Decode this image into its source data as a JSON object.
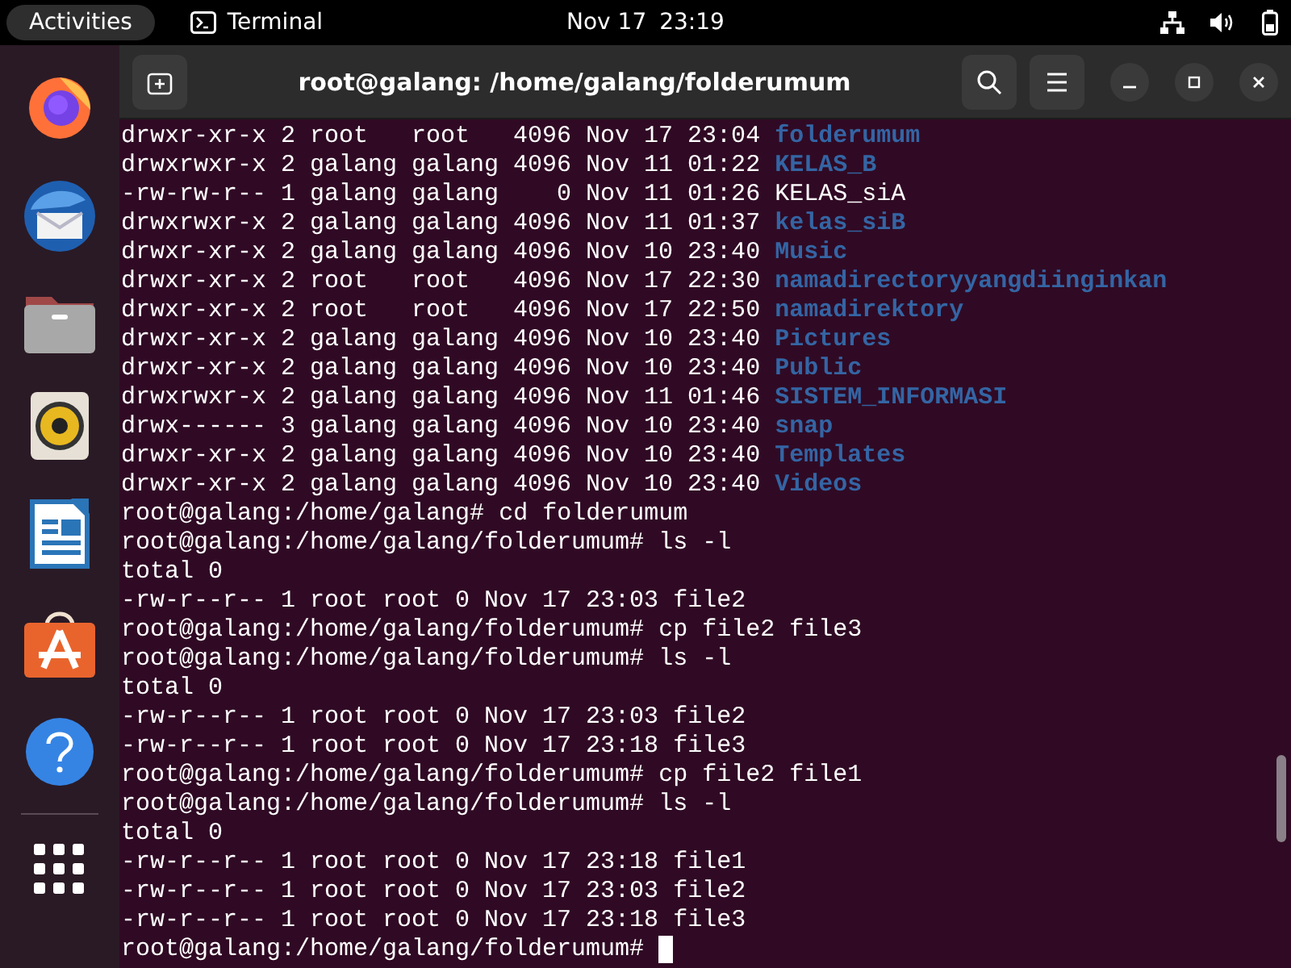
{
  "top_bar": {
    "activities": "Activities",
    "app_name": "Terminal",
    "date": "Nov 17",
    "time": "23:19"
  },
  "dock": {
    "items": [
      {
        "kind": "firefox"
      },
      {
        "kind": "thunderbird"
      },
      {
        "kind": "files"
      },
      {
        "kind": "rhythmbox"
      },
      {
        "kind": "writer"
      },
      {
        "kind": "software"
      },
      {
        "kind": "help"
      },
      {
        "kind": "apps"
      }
    ]
  },
  "window": {
    "title": "root@galang: /home/galang/folderumum"
  },
  "terminal": {
    "lines": [
      {
        "kind": "entry",
        "info": "drwxr-xr-x 2 root   root   4096 Nov 17 23:04",
        "name": "folderumum",
        "directory": true
      },
      {
        "kind": "entry",
        "info": "drwxrwxr-x 2 galang galang 4096 Nov 11 01:22",
        "name": "KELAS_B",
        "directory": true
      },
      {
        "kind": "entry",
        "info": "-rw-rw-r-- 1 galang galang    0 Nov 11 01:26",
        "name": "KELAS_siA",
        "directory": false
      },
      {
        "kind": "entry",
        "info": "drwxrwxr-x 2 galang galang 4096 Nov 11 01:37",
        "name": "kelas_siB",
        "directory": true
      },
      {
        "kind": "entry",
        "info": "drwxr-xr-x 2 galang galang 4096 Nov 10 23:40",
        "name": "Music",
        "directory": true
      },
      {
        "kind": "entry",
        "info": "drwxr-xr-x 2 root   root   4096 Nov 17 22:30",
        "name": "namadirectoryyangdiinginkan",
        "directory": true
      },
      {
        "kind": "entry",
        "info": "drwxr-xr-x 2 root   root   4096 Nov 17 22:50",
        "name": "namadirektory",
        "directory": true
      },
      {
        "kind": "entry",
        "info": "drwxr-xr-x 2 galang galang 4096 Nov 10 23:40",
        "name": "Pictures",
        "directory": true
      },
      {
        "kind": "entry",
        "info": "drwxr-xr-x 2 galang galang 4096 Nov 10 23:40",
        "name": "Public",
        "directory": true
      },
      {
        "kind": "entry",
        "info": "drwxrwxr-x 2 galang galang 4096 Nov 11 01:46",
        "name": "SISTEM_INFORMASI",
        "directory": true
      },
      {
        "kind": "entry",
        "info": "drwx------ 3 galang galang 4096 Nov 10 23:40",
        "name": "snap",
        "directory": true
      },
      {
        "kind": "entry",
        "info": "drwxr-xr-x 2 galang galang 4096 Nov 10 23:40",
        "name": "Templates",
        "directory": true
      },
      {
        "kind": "entry",
        "info": "drwxr-xr-x 2 galang galang 4096 Nov 10 23:40",
        "name": "Videos",
        "directory": true
      },
      {
        "kind": "prompt",
        "prompt": "root@galang:/home/galang#",
        "command": "cd folderumum",
        "cursor": false
      },
      {
        "kind": "prompt",
        "prompt": "root@galang:/home/galang/folderumum#",
        "command": "ls -l",
        "cursor": false
      },
      {
        "kind": "output",
        "text": "total 0"
      },
      {
        "kind": "entry",
        "info": "-rw-r--r-- 1 root root 0 Nov 17 23:03",
        "name": "file2",
        "directory": false
      },
      {
        "kind": "prompt",
        "prompt": "root@galang:/home/galang/folderumum#",
        "command": "cp file2 file3",
        "cursor": false
      },
      {
        "kind": "prompt",
        "prompt": "root@galang:/home/galang/folderumum#",
        "command": "ls -l",
        "cursor": false
      },
      {
        "kind": "output",
        "text": "total 0"
      },
      {
        "kind": "entry",
        "info": "-rw-r--r-- 1 root root 0 Nov 17 23:03",
        "name": "file2",
        "directory": false
      },
      {
        "kind": "entry",
        "info": "-rw-r--r-- 1 root root 0 Nov 17 23:18",
        "name": "file3",
        "directory": false
      },
      {
        "kind": "prompt",
        "prompt": "root@galang:/home/galang/folderumum#",
        "command": "cp file2 file1",
        "cursor": false
      },
      {
        "kind": "prompt",
        "prompt": "root@galang:/home/galang/folderumum#",
        "command": "ls -l",
        "cursor": false
      },
      {
        "kind": "output",
        "text": "total 0"
      },
      {
        "kind": "entry",
        "info": "-rw-r--r-- 1 root root 0 Nov 17 23:18",
        "name": "file1",
        "directory": false
      },
      {
        "kind": "entry",
        "info": "-rw-r--r-- 1 root root 0 Nov 17 23:03",
        "name": "file2",
        "directory": false
      },
      {
        "kind": "entry",
        "info": "-rw-r--r-- 1 root root 0 Nov 17 23:18",
        "name": "file3",
        "directory": false
      },
      {
        "kind": "prompt",
        "prompt": "root@galang:/home/galang/folderumum#",
        "cursor": true
      }
    ]
  }
}
